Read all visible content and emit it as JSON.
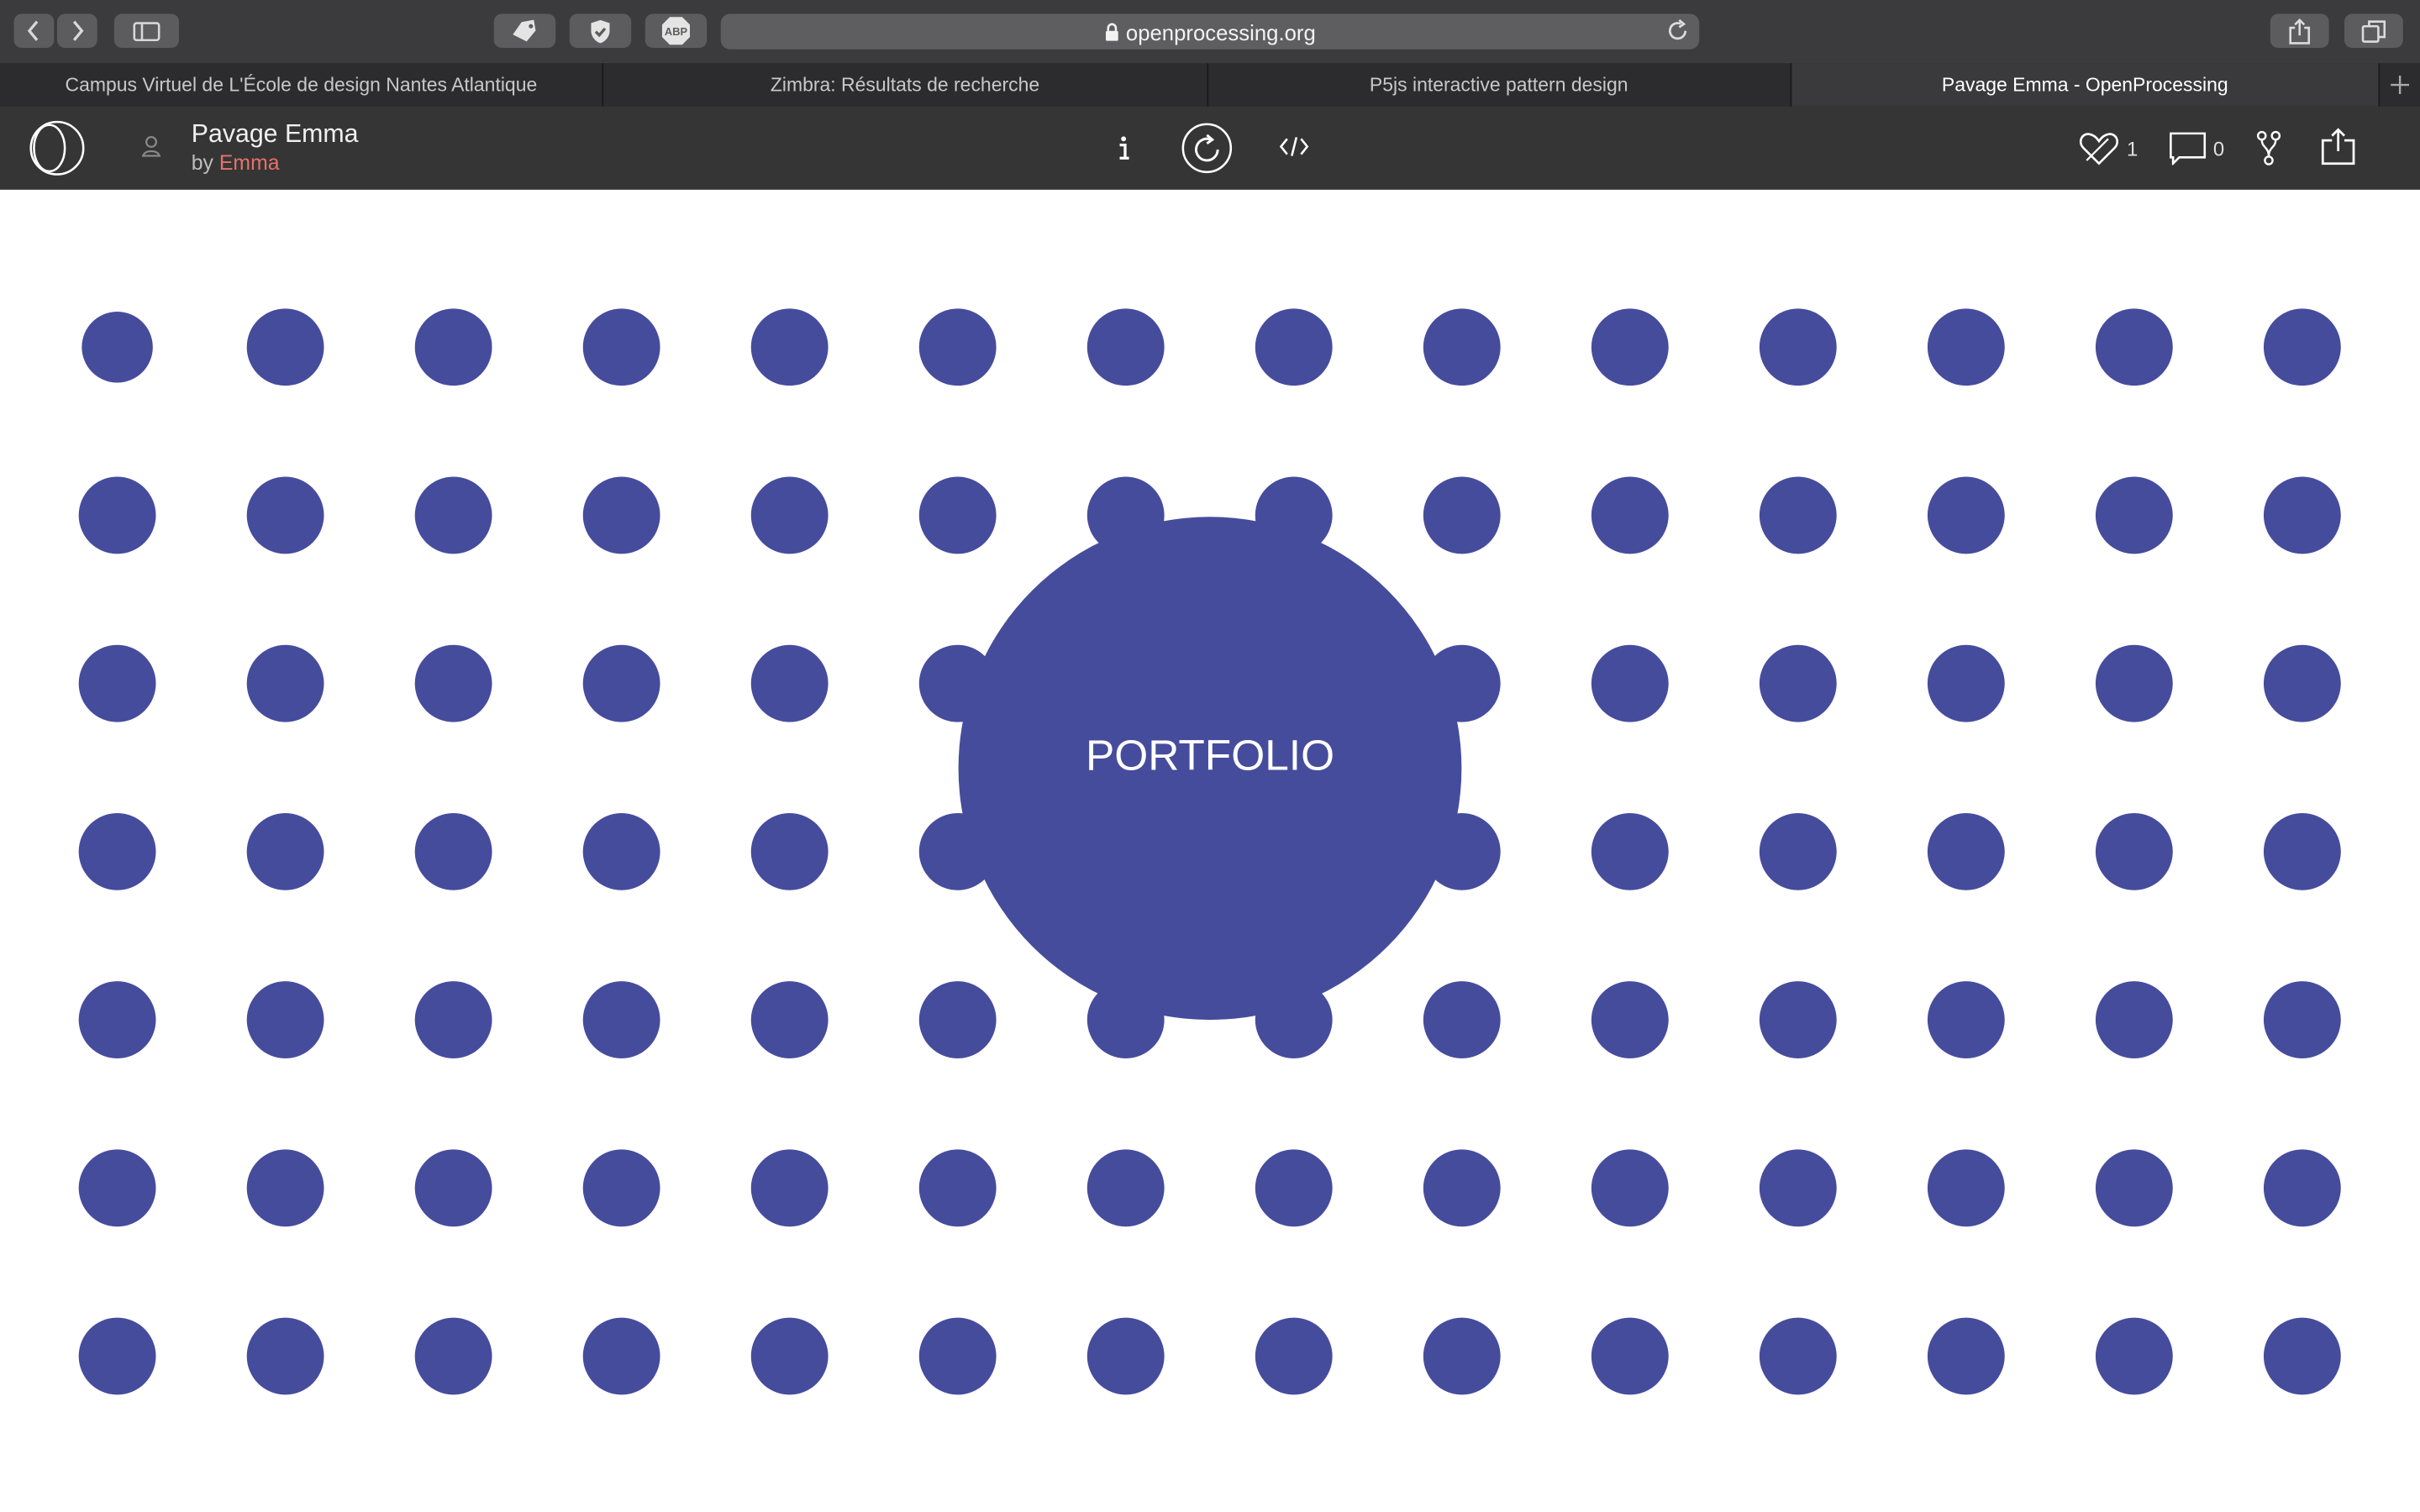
{
  "browser": {
    "url": "openprocessing.org",
    "tabs": [
      {
        "label": "Campus Virtuel de L'École de design Nantes Atlantique"
      },
      {
        "label": "Zimbra: Résultats de recherche"
      },
      {
        "label": "P5js interactive pattern design"
      },
      {
        "label": "Pavage Emma - OpenProcessing",
        "active": true
      }
    ],
    "abp_label": "ABP"
  },
  "sketch": {
    "title": "Pavage Emma",
    "by_prefix": "by",
    "author": "Emma",
    "likes": "1",
    "comments": "0"
  },
  "canvas": {
    "center_label": "PORTFOLIO",
    "grid_columns": 14,
    "grid_rows": 7,
    "colors": {
      "dot": "#464c9c",
      "background": "#ffffff",
      "label": "#ffffff"
    }
  }
}
